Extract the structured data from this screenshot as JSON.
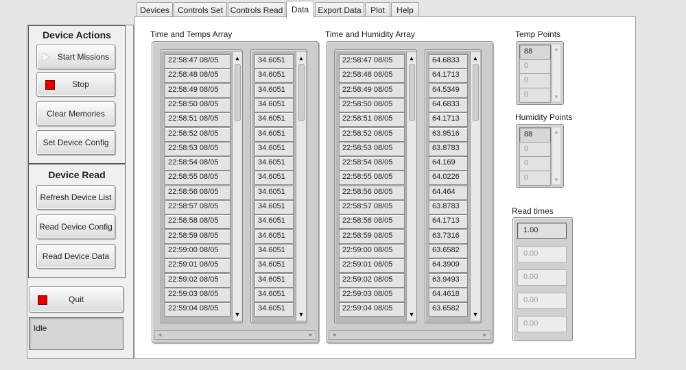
{
  "tabs": [
    {
      "label": "Devices"
    },
    {
      "label": "Controls Set"
    },
    {
      "label": "Controls Read"
    },
    {
      "label": "Data"
    },
    {
      "label": "Export Data"
    },
    {
      "label": "Plot"
    },
    {
      "label": "Help"
    }
  ],
  "active_tab": "Data",
  "device_actions": {
    "title": "Device Actions",
    "start_label": "Start Missions",
    "stop_label": "Stop",
    "clear_label": "Clear Memories",
    "set_config_label": "Set Device Config"
  },
  "device_read": {
    "title": "Device Read",
    "refresh_label": "Refresh Device List",
    "read_config_label": "Read Device Config",
    "read_data_label": "Read Device Data"
  },
  "quit_label": "Quit",
  "status_text": "Idle",
  "temps_array": {
    "label": "Time and Temps Array",
    "times": [
      "22:58:47  08/05",
      "22:58:48  08/05",
      "22:58:49  08/05",
      "22:58:50  08/05",
      "22:58:51  08/05",
      "22:58:52  08/05",
      "22:58:53  08/05",
      "22:58:54  08/05",
      "22:58:55  08/05",
      "22:58:56  08/05",
      "22:58:57  08/05",
      "22:58:58  08/05",
      "22:58:59  08/05",
      "22:59:00  08/05",
      "22:59:01  08/05",
      "22:59:02  08/05",
      "22:59:03  08/05",
      "22:59:04  08/05"
    ],
    "values": [
      "34.6051",
      "34.6051",
      "34.6051",
      "34.6051",
      "34.6051",
      "34.6051",
      "34.6051",
      "34.6051",
      "34.6051",
      "34.6051",
      "34.6051",
      "34.6051",
      "34.6051",
      "34.6051",
      "34.6051",
      "34.6051",
      "34.6051",
      "34.6051"
    ]
  },
  "humidity_array": {
    "label": "Time and Humidity Array",
    "times": [
      "22:58:47  08/05",
      "22:58:48  08/05",
      "22:58:49  08/05",
      "22:58:50  08/05",
      "22:58:51  08/05",
      "22:58:52  08/05",
      "22:58:53  08/05",
      "22:58:54  08/05",
      "22:58:55  08/05",
      "22:58:56  08/05",
      "22:58:57  08/05",
      "22:58:58  08/05",
      "22:58:59  08/05",
      "22:59:00  08/05",
      "22:59:01  08/05",
      "22:59:02  08/05",
      "22:59:03  08/05",
      "22:59:04  08/05"
    ],
    "values": [
      "64.6833",
      "64.1713",
      "64.5349",
      "64.6833",
      "64.1713",
      "63.9516",
      "63.8783",
      "64.169",
      "64.0226",
      "64.464",
      "63.8783",
      "64.1713",
      "63.7316",
      "63.6582",
      "64.3909",
      "63.9493",
      "64.4618",
      "63.6582"
    ]
  },
  "temp_points": {
    "label": "Temp Points",
    "values": [
      "88",
      "0",
      "0",
      "0"
    ]
  },
  "humidity_points": {
    "label": "Humidity Points",
    "values": [
      "88",
      "0",
      "0",
      "0"
    ]
  },
  "read_times": {
    "label": "Read times",
    "values": [
      "1.00",
      "0.00",
      "0.00",
      "0.00",
      "0.00"
    ]
  },
  "icons": {
    "start": "play-icon",
    "stop": "stop-icon",
    "quit": "stop-icon",
    "scroll_up": "arrow-up-icon",
    "scroll_down": "arrow-down-icon"
  },
  "colors": {
    "stop_red": "#e00000",
    "panel_bg": "#f0f0f0",
    "window_bg": "#e6e6e6"
  }
}
